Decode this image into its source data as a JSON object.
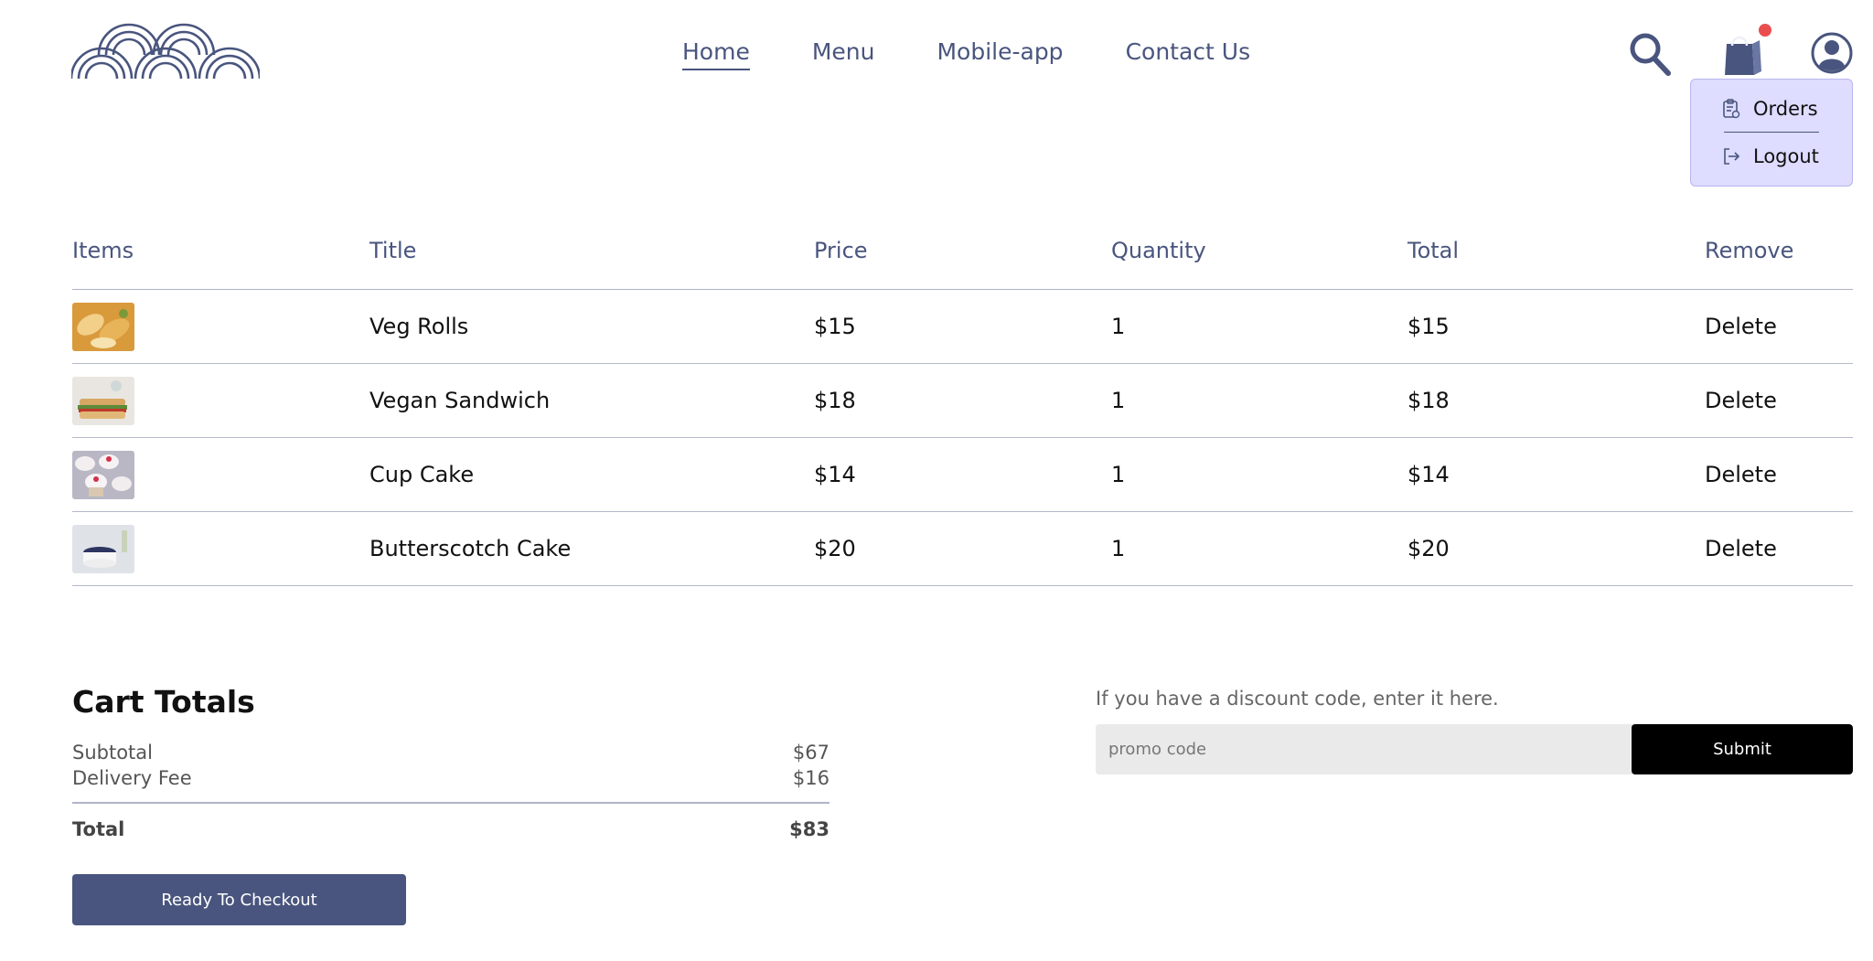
{
  "brand": {
    "logo_icon": "wave-scales-logo",
    "accent_color": "#49557e"
  },
  "nav": {
    "items": [
      {
        "label": "Home",
        "active": true
      },
      {
        "label": "Menu",
        "active": false
      },
      {
        "label": "Mobile-app",
        "active": false
      },
      {
        "label": "Contact Us",
        "active": false
      }
    ]
  },
  "header_icons": {
    "search": "search-icon",
    "cart": "shopping-bag-icon",
    "profile": "profile-icon",
    "cart_badge_color": "#ea4d4d"
  },
  "profile_dropdown": {
    "items": [
      {
        "label": "Orders",
        "icon": "orders-clipboard-icon"
      },
      {
        "label": "Logout",
        "icon": "logout-icon"
      }
    ]
  },
  "cart_table": {
    "columns": [
      "Items",
      "Title",
      "Price",
      "Quantity",
      "Total",
      "Remove"
    ],
    "rows": [
      {
        "title": "Veg Rolls",
        "price": "$15",
        "quantity": "1",
        "total": "$15",
        "remove": "Delete"
      },
      {
        "title": "Vegan Sandwich",
        "price": "$18",
        "quantity": "1",
        "total": "$18",
        "remove": "Delete"
      },
      {
        "title": "Cup Cake",
        "price": "$14",
        "quantity": "1",
        "total": "$14",
        "remove": "Delete"
      },
      {
        "title": "Butterscotch Cake",
        "price": "$20",
        "quantity": "1",
        "total": "$20",
        "remove": "Delete"
      }
    ]
  },
  "cart_totals": {
    "heading": "Cart Totals",
    "subtotal_label": "Subtotal",
    "subtotal_value": "$67",
    "delivery_label": "Delivery Fee",
    "delivery_value": "$16",
    "total_label": "Total",
    "total_value": "$83",
    "checkout_label": "Ready To Checkout"
  },
  "promo": {
    "label": "If you have a discount code, enter it here.",
    "placeholder": "promo code",
    "value": "",
    "submit_label": "Submit"
  }
}
